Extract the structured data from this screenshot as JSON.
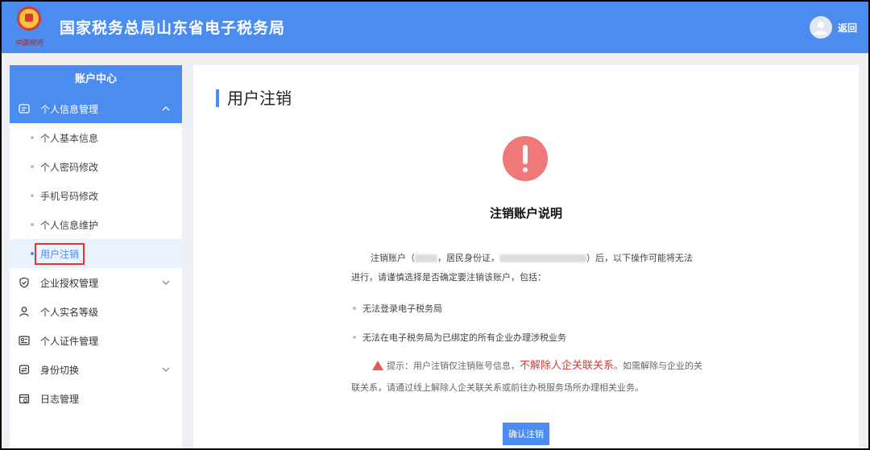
{
  "header": {
    "logo_text": "中国税务",
    "title": "国家税务总局山东省电子税务局",
    "back_label": "返回"
  },
  "sidebar": {
    "header": "账户中心",
    "groups": [
      {
        "label": "个人信息管理",
        "expanded": true
      },
      {
        "label": "企业授权管理",
        "expanded": false
      },
      {
        "label": "个人实名等级"
      },
      {
        "label": "个人证件管理"
      },
      {
        "label": "身份切换",
        "expanded": false
      },
      {
        "label": "日志管理"
      }
    ],
    "sub_items": [
      {
        "label": "个人基本信息"
      },
      {
        "label": "个人密码修改"
      },
      {
        "label": "手机号码修改"
      },
      {
        "label": "个人信息维护"
      },
      {
        "label": "用户注销",
        "selected": true
      }
    ]
  },
  "main": {
    "page_title": "用户注销",
    "notice_title": "注销账户说明",
    "para_part1": "注销账户（",
    "para_part2": "，居民身份证，",
    "para_part3": "）后，以下操作可能将无法进行，请谨慎选择是否确定要注销该账户，包括：",
    "bullets": [
      "无法登录电子税务局",
      "无法在电子税务局为已绑定的所有企业办理涉税业务"
    ],
    "tip_prefix": "提示：用户注销仅注销账号信息，",
    "tip_emphasis": "不解除人企关联关系",
    "tip_suffix": "。如需解除与企业的关联关系，请通过线上解除人企关联关系或前往办税服务场所办理相关业务。",
    "confirm_label": "确认注销"
  },
  "colors": {
    "brand": "#4a8cf0",
    "warning": "#f07878",
    "emphasis": "#e03535"
  }
}
